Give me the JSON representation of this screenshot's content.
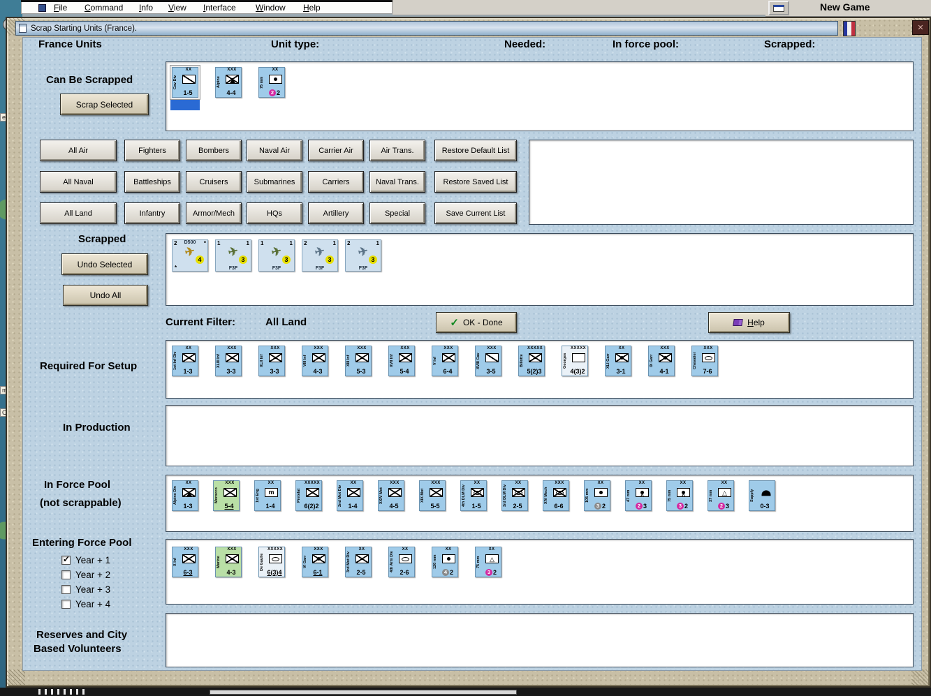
{
  "colors": {
    "magenta": "#d428a0",
    "gray": "#8a8a8a",
    "yellow": "#e8e000",
    "counter_blue": "#9fcbe9",
    "counter_green": "#b9dfa6",
    "selection_blue": "#2a6ad4"
  },
  "icons": {
    "plane": "✈",
    "check": "✓",
    "close": "✕"
  },
  "background": {
    "menu_items": [
      "File",
      "Command",
      "Info",
      "View",
      "Interface",
      "Window",
      "Help"
    ],
    "new_game_label": "New Game",
    "map_labels": [
      "e.",
      "md",
      "C"
    ]
  },
  "window": {
    "title": "Scrap Starting Units (France)."
  },
  "headers": {
    "left": "France Units",
    "unit_type": "Unit type:",
    "needed": "Needed:",
    "in_force_pool": "In force pool:",
    "scrapped": "Scrapped:"
  },
  "can_be_scrapped": {
    "label": "Can Be Scrapped",
    "button": "Scrap Selected",
    "units": [
      {
        "name": "Cav Div",
        "ech": "XX",
        "sym": "cav",
        "str": "1-5",
        "sel": true
      },
      {
        "name": "Alpine",
        "ech": "XXX",
        "sym": "mtn",
        "str": "4-4"
      },
      {
        "name": "75 mm",
        "ech": "XX",
        "sym": "art",
        "circ": "2",
        "ccol": "magenta",
        "str": "2"
      }
    ]
  },
  "filters": {
    "rows": [
      [
        "All Air",
        "Fighters",
        "Bombers",
        "Naval Air",
        "Carrier Air",
        "Air Trans."
      ],
      [
        "All Naval",
        "Battleships",
        "Cruisers",
        "Submarines",
        "Carriers",
        "Naval Trans."
      ],
      [
        "All Land",
        "Infantry",
        "Armor/Mech",
        "HQs",
        "Artillery",
        "Special"
      ]
    ],
    "list_buttons": [
      "Restore Default List",
      "Restore Saved List",
      "Save Current List"
    ]
  },
  "scrapped": {
    "label": "Scrapped",
    "undo_selected": "Undo Selected",
    "undo_all": "Undo All",
    "planes": [
      {
        "tl": "2",
        "top": "D500",
        "tr": "*",
        "circ": "4",
        "bl": "*",
        "bottom": "",
        "color": "#b08818"
      },
      {
        "tl": "1",
        "tr": "1",
        "circ": "3",
        "bottom": "F3F",
        "color": "#5a7038"
      },
      {
        "tl": "1",
        "tr": "1",
        "circ": "3",
        "bottom": "F3F",
        "color": "#5a7038"
      },
      {
        "tl": "2",
        "tr": "1",
        "circ": "3",
        "bottom": "F3F",
        "color": "#5c7488"
      },
      {
        "tl": "2",
        "tr": "1",
        "circ": "3",
        "bottom": "F3F",
        "color": "#5c7488"
      }
    ]
  },
  "filter_bar": {
    "label": "Current Filter:",
    "value": "All Land",
    "ok_button": "OK - Done",
    "help_button": "Help"
  },
  "required_for_setup": {
    "label": "Required For Setup",
    "units": [
      {
        "name": "1st Inf Div",
        "ech": "XX",
        "sym": "inf",
        "str": "1-3"
      },
      {
        "name": "XLIII Inf",
        "ech": "XXX",
        "sym": "inf",
        "str": "3-3"
      },
      {
        "name": "XLII Inf",
        "ech": "XXX",
        "sym": "inf",
        "str": "3-3"
      },
      {
        "name": "VIII Inf",
        "ech": "XXX",
        "sym": "inf",
        "str": "4-3"
      },
      {
        "name": "XIII Inf",
        "ech": "XXX",
        "sym": "inf",
        "str": "5-3"
      },
      {
        "name": "XVII Inf",
        "ech": "XXX",
        "sym": "inf",
        "str": "5-4"
      },
      {
        "name": "V Inf",
        "ech": "XXX",
        "sym": "inf",
        "str": "6-4"
      },
      {
        "name": "XVIII Cav",
        "ech": "XXX",
        "sym": "cav",
        "str": "3-5"
      },
      {
        "name": "Billotte",
        "ech": "XXXXX",
        "sym": "inf",
        "str": "5(2)3"
      },
      {
        "name": "Georges",
        "ech": "XXXXX",
        "sym": "hq",
        "str": "4(3)2",
        "tint": "white"
      },
      {
        "name": "XLI Garr",
        "ech": "XX",
        "sym": "garr",
        "str": "3-1"
      },
      {
        "name": "IX Garr",
        "ech": "XXX",
        "sym": "garr",
        "str": "4-1"
      },
      {
        "name": "Chevalier",
        "ech": "XXX",
        "sym": "arm",
        "str": "7-6"
      }
    ]
  },
  "in_production": {
    "label": "In Production",
    "units": []
  },
  "in_force_pool": {
    "label_line1": "In Force Pool",
    "label_line2": "(not scrappable)",
    "units": [
      {
        "name": "Alpine Div",
        "ech": "XX",
        "sym": "mtn",
        "str": "1-3"
      },
      {
        "name": "Morocco",
        "ech": "XXX",
        "sym": "inf",
        "str": "5-4",
        "tint": "green",
        "ul": true
      },
      {
        "name": "1st Eng",
        "ech": "XX",
        "sym": "eng",
        "str": "1-4"
      },
      {
        "name": "Pretelat",
        "ech": "XXXXX",
        "sym": "inf",
        "str": "6(2)2"
      },
      {
        "name": "2nd Mot Div",
        "ech": "XX",
        "sym": "inf",
        "str": "1-4"
      },
      {
        "name": "XXIV Mot",
        "ech": "XXX",
        "sym": "inf",
        "str": "4-5"
      },
      {
        "name": "XIX Mot",
        "ech": "XXX",
        "sym": "inf",
        "str": "5-5"
      },
      {
        "name": "4th DLM Div",
        "ech": "XX",
        "sym": "mech",
        "str": "1-5"
      },
      {
        "name": "3rd DLM Div",
        "ech": "XX",
        "sym": "mech",
        "str": "2-5"
      },
      {
        "name": "XIV Mech",
        "ech": "XXX",
        "sym": "mech",
        "str": "6-6"
      },
      {
        "name": "105 mm",
        "ech": "XX",
        "sym": "art",
        "circ": "3",
        "ccol": "gray",
        "str": "2"
      },
      {
        "name": "47 mm",
        "ech": "XX",
        "sym": "at",
        "circ": "2",
        "ccol": "magenta",
        "str": "3"
      },
      {
        "name": "75 mm",
        "ech": "XX",
        "sym": "at",
        "circ": "3",
        "ccol": "magenta",
        "str": "2"
      },
      {
        "name": "37 mm",
        "ech": "XX",
        "sym": "aa",
        "circ": "2",
        "ccol": "magenta",
        "str": "3"
      },
      {
        "name": "Supply",
        "ech": "",
        "sym": "supply",
        "str": "0-3"
      }
    ]
  },
  "entering_force_pool": {
    "label": "Entering Force Pool",
    "checkboxes": [
      {
        "label": "Year + 1",
        "checked": true
      },
      {
        "label": "Year + 2",
        "checked": false
      },
      {
        "label": "Year + 3",
        "checked": false
      },
      {
        "label": "Year + 4",
        "checked": false
      }
    ],
    "units": [
      {
        "name": "X Inf",
        "ech": "XXX",
        "sym": "inf",
        "str": "6-3",
        "ul": true
      },
      {
        "name": "Marine",
        "ech": "XXX",
        "sym": "inf",
        "str": "4-3",
        "tint": "green"
      },
      {
        "name": "De Gaulle",
        "ech": "XXXXX",
        "sym": "arm",
        "str": "6(3)4",
        "tint": "white",
        "ul": true
      },
      {
        "name": "VI Garr",
        "ech": "XXX",
        "sym": "garr",
        "str": "6-1",
        "ul": true
      },
      {
        "name": "3rd Mot Div",
        "ech": "XX",
        "sym": "inf",
        "str": "2-5"
      },
      {
        "name": "4th Arm Div",
        "ech": "XX",
        "sym": "arm",
        "str": "2-6"
      },
      {
        "name": "120 mm",
        "ech": "XX",
        "sym": "art",
        "circ": "4",
        "ccol": "gray",
        "str": "2"
      },
      {
        "name": "75 mm",
        "ech": "XX",
        "sym": "aa",
        "circ": "3",
        "ccol": "magenta",
        "str": "2"
      }
    ]
  },
  "reserves": {
    "label_line1": "Reserves and City",
    "label_line2": "Based Volunteers",
    "units": []
  }
}
